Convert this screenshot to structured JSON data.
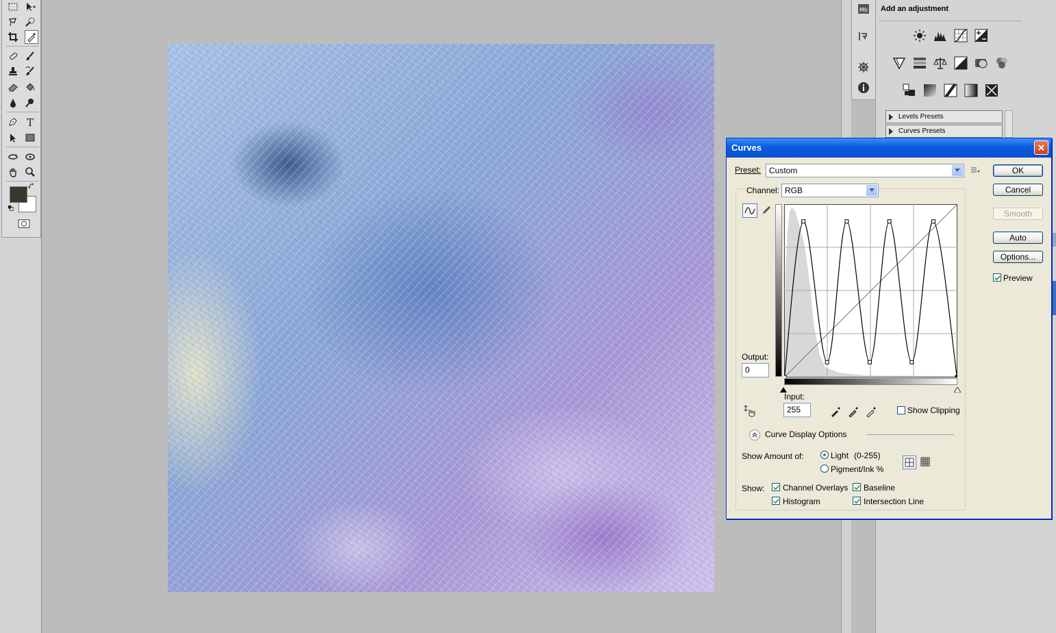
{
  "adjustments_panel": {
    "title": "Add an adjustment",
    "icon_rows": [
      [
        "brightness-contrast-icon",
        "levels-icon",
        "curves-icon",
        "exposure-icon"
      ],
      [
        "vibrance-icon",
        "hue-saturation-icon",
        "color-balance-icon",
        "black-white-icon",
        "photo-filter-icon",
        "channel-mixer-icon"
      ],
      [
        "invert-icon",
        "posterize-icon",
        "threshold-icon",
        "gradient-map-icon",
        "selective-color-icon"
      ]
    ],
    "presets": [
      "Levels Presets",
      "Curves Presets"
    ]
  },
  "dock_icons": [
    "mini-bridge-icon",
    "history-icon",
    "navigator-icon",
    "info-icon"
  ],
  "dialog": {
    "title": "Curves",
    "preset_label": "Preset:",
    "preset_value": "Custom",
    "channel_label": "Channel:",
    "channel_value": "RGB",
    "output_label": "Output:",
    "output_value": "0",
    "input_label": "Input:",
    "input_value": "255",
    "show_clipping": "Show Clipping",
    "curve_display_options": "Curve Display Options",
    "show_amount_label": "Show Amount of:",
    "light_option": "Light",
    "light_range": "(0-255)",
    "pigment_option": "Pigment/Ink %",
    "show_label": "Show:",
    "channel_overlays": "Channel Overlays",
    "baseline": "Baseline",
    "histogram": "Histogram",
    "intersection_line": "Intersection Line",
    "buttons": {
      "ok": "OK",
      "cancel": "Cancel",
      "smooth": "Smooth",
      "auto": "Auto",
      "options": "Options..."
    },
    "preview_label": "Preview",
    "curve_points": [
      [
        0,
        0
      ],
      [
        28,
        230
      ],
      [
        63,
        22
      ],
      [
        92,
        230
      ],
      [
        126,
        22
      ],
      [
        155,
        230
      ],
      [
        188,
        22
      ],
      [
        220,
        230
      ],
      [
        255,
        0
      ]
    ]
  }
}
